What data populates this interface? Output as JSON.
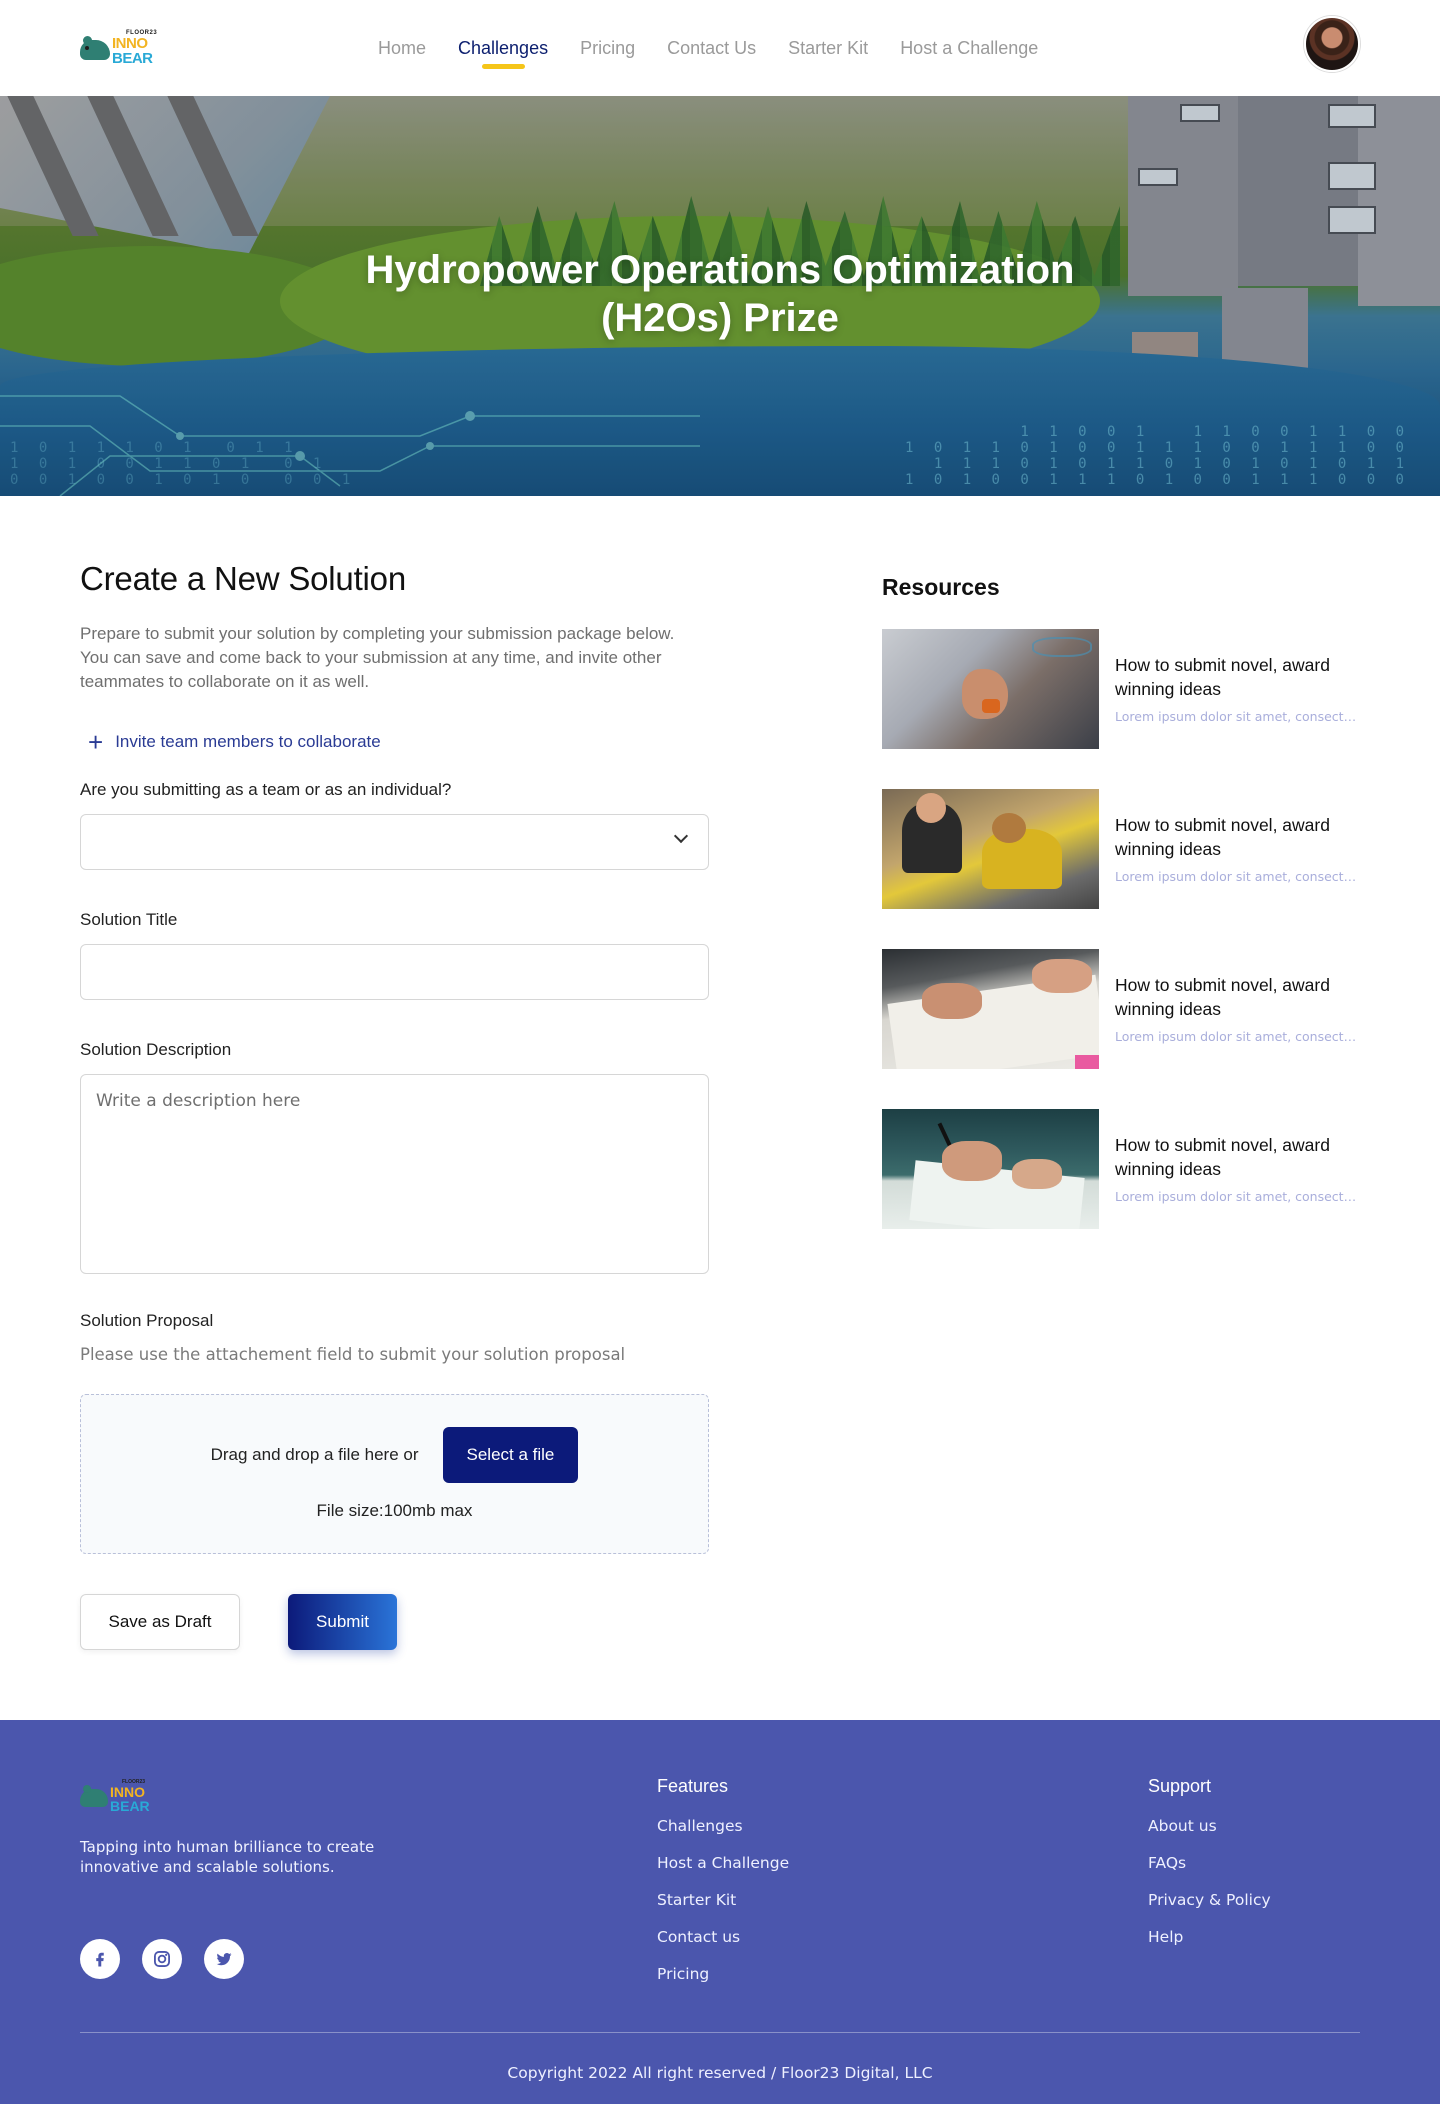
{
  "nav": {
    "logo": {
      "small": "FLOOR23",
      "inno": "INNO",
      "bear": "BEAR"
    },
    "links": [
      "Home",
      "Challenges",
      "Pricing",
      "Contact Us",
      "Starter Kit",
      "Host a Challenge"
    ],
    "active": "Challenges"
  },
  "hero": {
    "title": "Hydropower Operations Optimization (H2Os) Prize",
    "digits_right": "1 1 0 0 1   1 1 0 0 1 1 0 0\n1 0 1 1 0 1 0 0 1 1 1 0 0 1 1 1 0 0\n1 1 1 0 1 0 1 1 0 1 0 1 0 1 0 1 1\n1 0 1 0 0 1 1 1 0 1 0 0 1 1 1 0 0 0",
    "digits_left": "1 0 1 1 1 0 1  0 1 1\n1 0 1 0 0 1 1 0 1  0 1\n0 0 1 0 0 1 0 1 0  0 0 1"
  },
  "form": {
    "title": "Create a New Solution",
    "intro": "Prepare to submit your solution by completing your submission package below. You can save and come back to your submission at any time, and invite other teammates to collaborate on it as well.",
    "invite_label": "Invite team members to collaborate",
    "team_question": "Are you submitting as a team or as an individual?",
    "team_value": "",
    "title_label": "Solution Title",
    "title_value": "",
    "description_label": "Solution Description",
    "description_placeholder": "Write a description here",
    "proposal_label": "Solution Proposal",
    "proposal_hint": "Please use the attachement field to submit your solution proposal",
    "dropzone_text": "Drag and drop a file here or",
    "select_file_label": "Select a file",
    "file_size_text": "File size:100mb max",
    "save_draft_label": "Save as Draft",
    "submit_label": "Submit"
  },
  "resources": {
    "title": "Resources",
    "items": [
      {
        "title": "How to submit novel, award winning ideas",
        "desc": "Lorem ipsum dolor sit amet, consectetur adipiscing eli elit Quam..."
      },
      {
        "title": "How to submit novel, award winning ideas",
        "desc": "Lorem ipsum dolor sit amet, consectetur adipiscing eli elit Quam..."
      },
      {
        "title": "How to submit novel, award winning ideas",
        "desc": "Lorem ipsum dolor sit amet, consectetur adipiscing eli elit Quam..."
      },
      {
        "title": "How to submit novel, award winning ideas",
        "desc": "Lorem ipsum dolor sit amet, consectetur adipiscing eli elit Quam..."
      }
    ]
  },
  "footer": {
    "tagline": "Tapping into human brilliance to create innovative and scalable solutions.",
    "features_title": "Features",
    "features": [
      "Challenges",
      "Host a Challenge",
      "Starter Kit",
      "Contact us",
      "Pricing"
    ],
    "support_title": "Support",
    "support": [
      "About us",
      "FAQs",
      "Privacy & Policy",
      "Help"
    ],
    "socials": [
      "facebook-icon",
      "instagram-icon",
      "twitter-icon"
    ],
    "copyright": "Copyright 2022 All right reserved /  Floor23 Digital, LLC"
  },
  "colors": {
    "brand": "#0c1a7a",
    "accent": "#f5c519",
    "footer": "#4b56ad",
    "link": "#2a3b94"
  }
}
